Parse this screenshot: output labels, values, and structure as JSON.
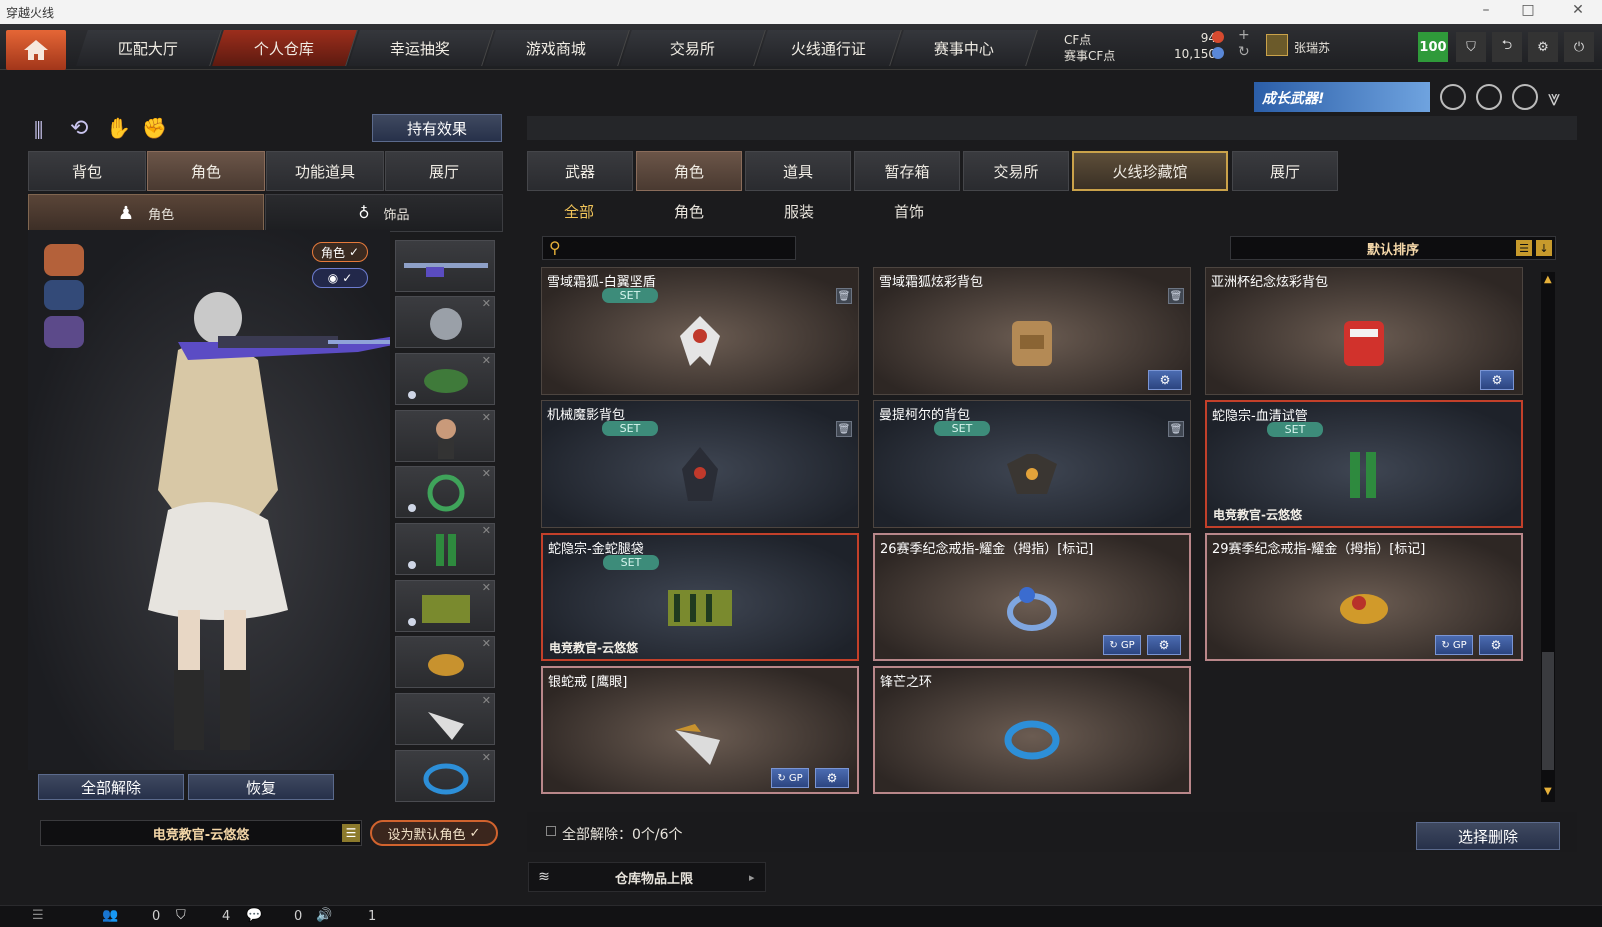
{
  "window": {
    "title": "穿越火线"
  },
  "nav": {
    "tabs": [
      "匹配大厅",
      "个人仓库",
      "幸运抽奖",
      "游戏商城",
      "交易所",
      "火线通行证",
      "赛事中心"
    ],
    "active_index": 1
  },
  "header": {
    "cf_label": "CF点",
    "cf_value": "94",
    "match_cf_label": "赛事CF点",
    "match_cf_value": "10,150",
    "username": "张瑞苏",
    "level": "100",
    "banner_text": "成长武器!"
  },
  "left": {
    "hold_effect_button": "持有效果",
    "tabs": [
      "背包",
      "角色",
      "功能道具",
      "展厅"
    ],
    "active_tab": 1,
    "subtabs": [
      "角色",
      "饰品"
    ],
    "active_subtab": 0,
    "toggle_role": "角色",
    "release_all_button": "全部解除",
    "restore_button": "恢复",
    "current_role": "电竞教官-云悠悠",
    "set_default_button": "设为默认角色"
  },
  "right": {
    "tabs": [
      "武器",
      "角色",
      "道具",
      "暂存箱",
      "交易所",
      "火线珍藏馆",
      "展厅"
    ],
    "active_tab": 5,
    "subtabs": [
      "全部",
      "角色",
      "服装",
      "首饰"
    ],
    "active_subtab": 0,
    "search_placeholder": "",
    "sort_label": "默认排序",
    "release_all_text": "全部解除：0个/6个",
    "select_delete_button": "选择删除",
    "storage_limit": "仓库物品上限",
    "items": [
      {
        "name": "雪域霜狐-白翼坚盾",
        "set": "SET",
        "owner": "",
        "trash": true,
        "gear": false,
        "gp": false
      },
      {
        "name": "雪域霜狐炫彩背包",
        "set": "",
        "owner": "",
        "trash": true,
        "gear": true,
        "gp": false
      },
      {
        "name": "亚洲杯纪念炫彩背包",
        "set": "",
        "owner": "",
        "trash": false,
        "gear": true,
        "gp": false
      },
      {
        "name": "机械魔影背包",
        "set": "SET",
        "owner": "",
        "trash": true,
        "gear": false,
        "gp": false
      },
      {
        "name": "曼提柯尔的背包",
        "set": "SET",
        "owner": "",
        "trash": true,
        "gear": false,
        "gp": false
      },
      {
        "name": "蛇隐宗-血清试管",
        "set": "SET",
        "owner": "电竞教官-云悠悠",
        "trash": false,
        "gear": false,
        "gp": false
      },
      {
        "name": "蛇隐宗-金蛇腿袋",
        "set": "SET",
        "owner": "电竞教官-云悠悠",
        "trash": false,
        "gear": false,
        "gp": false
      },
      {
        "name": "26赛季纪念戒指-耀金（拇指）[标记]",
        "set": "",
        "owner": "",
        "trash": false,
        "gear": true,
        "gp": true
      },
      {
        "name": "29赛季纪念戒指-耀金（拇指）[标记]",
        "set": "",
        "owner": "",
        "trash": false,
        "gear": true,
        "gp": true
      },
      {
        "name": "银蛇戒 [鹰眼]",
        "set": "",
        "owner": "",
        "trash": false,
        "gear": true,
        "gp": true
      },
      {
        "name": "锋芒之环",
        "set": "",
        "owner": "",
        "trash": false,
        "gear": false,
        "gp": false
      }
    ]
  },
  "statusbar": {
    "count1": "0",
    "count2": "4",
    "count3": "0",
    "count4": "1"
  }
}
